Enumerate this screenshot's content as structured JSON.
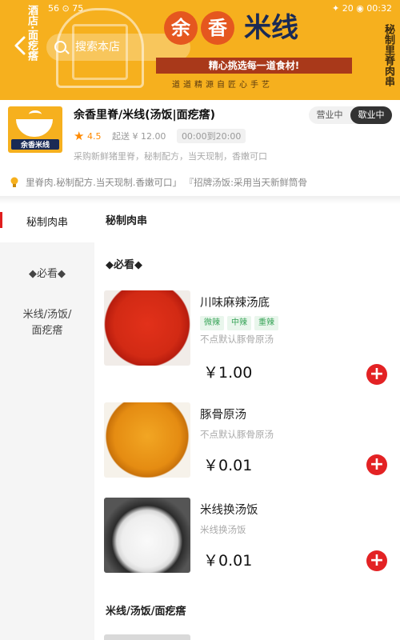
{
  "status_bar": {
    "left": "56 ⊙ 75",
    "right": "✦ 20 ◉ 00:32"
  },
  "header": {
    "back_icon": "chevron-left-icon",
    "search_placeholder": "搜索本店",
    "brand_circle_1": "余",
    "brand_circle_2": "香",
    "brand_word": "米线",
    "ribbon": "精心挑选每一道食材!",
    "tagline": "道道精源自匠心手艺",
    "side_left": "酒店·面疙瘩",
    "side_right": "秘制里脊肉串"
  },
  "shop": {
    "logo_text": "余香米线",
    "name": "余香里脊/米线(汤饭|面疙瘩)",
    "rating": "4.5",
    "min_order": "起送 ¥ 12.00",
    "hours": "00:00到20:00",
    "description": "采购新鲜猪里脊，秘制配方，当天现制，香嫩可口",
    "status_open": "营业中",
    "status_closed": "歇业中",
    "notice": "里脊肉.秘制配方.当天现制.香嫩可口」 『招牌汤饭:采用当天新鲜筒骨"
  },
  "sidebar": {
    "items": [
      {
        "label": "秘制肉串"
      },
      {
        "label": "◆必看◆"
      },
      {
        "label_line1": "米线/汤饭/",
        "label_line2": "面疙瘩"
      }
    ]
  },
  "content": {
    "section1_title": "秘制肉串",
    "section2_title": "◆必看◆",
    "section3_title": "米线/汤饭/面疙瘩",
    "items": [
      {
        "name": "川味麻辣汤底",
        "tags": [
          "微辣",
          "中辣",
          "重辣"
        ],
        "sub": "不点默认豚骨原汤",
        "price": "￥1.00"
      },
      {
        "name": "豚骨原汤",
        "sub": "不点默认豚骨原汤",
        "price": "￥0.01"
      },
      {
        "name": "米线换汤饭",
        "sub": "米线换汤饭",
        "price": "￥0.01"
      }
    ]
  }
}
